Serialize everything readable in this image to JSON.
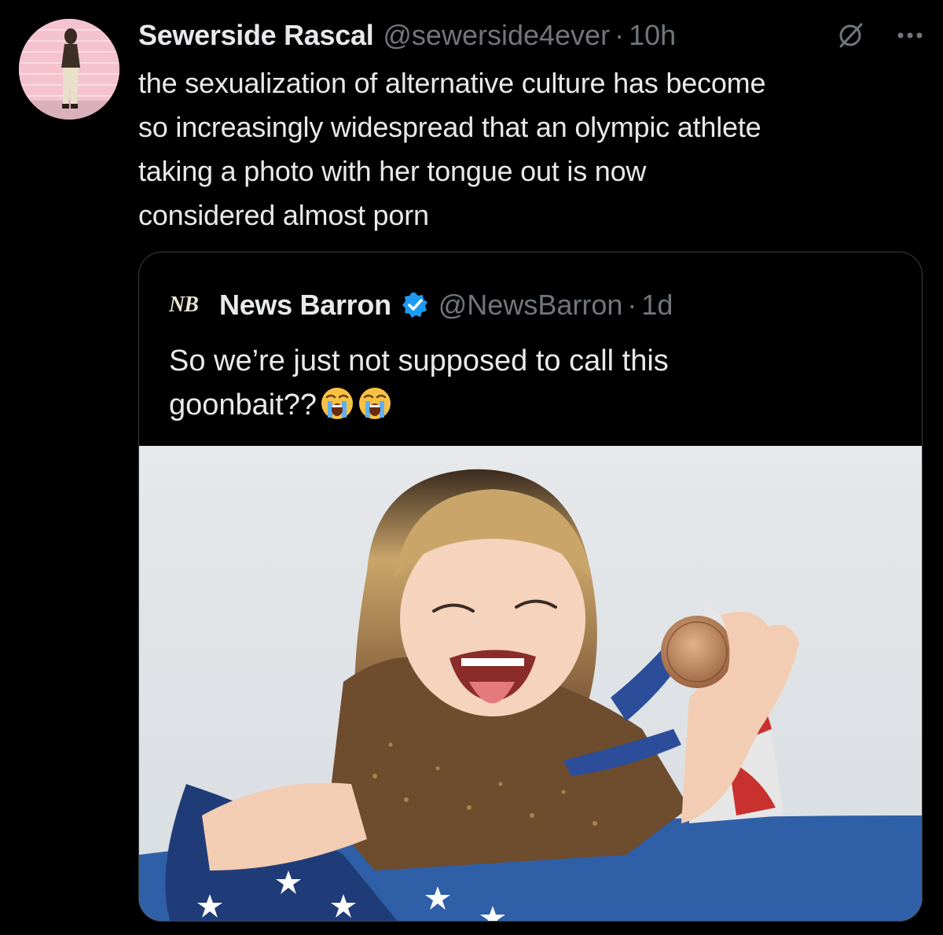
{
  "tweet": {
    "display_name": "Sewerside Rascal",
    "handle": "@sewerside4ever",
    "separator": "·",
    "time": "10h",
    "text": "the sexualization of alternative culture has become\nso increasingly widespread that an olympic athlete\ntaking a photo with her tongue out is now\nconsidered almost porn"
  },
  "quote": {
    "logo_text": "NB",
    "display_name": "News Barron",
    "handle": "@NewsBarron",
    "separator": "·",
    "time": "1d",
    "text": "So we’re just not supposed to call this\ngoonbait??"
  },
  "colors": {
    "background": "#000000",
    "primary_text": "#e7e9ea",
    "secondary_text": "#71767b",
    "border": "#3a3d41",
    "verified_badge": "#1d9bf0"
  },
  "icons": {
    "grok": "grok-slash-icon",
    "more": "more-horizontal-icon",
    "verified": "verified-badge-icon",
    "emoji": "loudly-crying-face-emoji"
  }
}
